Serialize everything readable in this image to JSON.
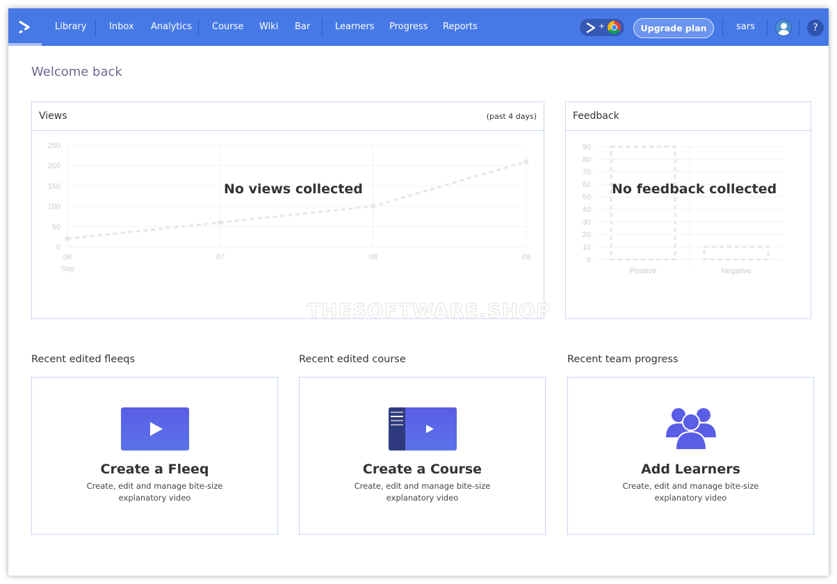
{
  "nav": {
    "items": [
      "Library",
      "Inbox",
      "Analytics",
      "Course",
      "Wiki",
      "Bar",
      "Learners",
      "Progress",
      "Reports"
    ],
    "active": "Library",
    "upgrade": "Upgrade plan",
    "user": "sars",
    "help": "?",
    "ext_plus": "+",
    "accent": "#4779e6"
  },
  "welcome": "Welcome back",
  "views": {
    "title": "Views",
    "range": "(past 4 days)",
    "empty": "No views collected"
  },
  "feedback": {
    "title": "Feedback",
    "empty": "No feedback collected"
  },
  "watermark": "THESOFTWARE.SHOP",
  "sections": {
    "fleeqs": "Recent edited fleeqs",
    "course": "Recent edited course",
    "team": "Recent team progress"
  },
  "cards": [
    {
      "title": "Create a Fleeq",
      "desc": "Create, edit and manage bite-size explanatory video",
      "icon": "video-play-icon"
    },
    {
      "title": "Create a Course",
      "desc": "Create, edit and manage bite-size explanatory video",
      "icon": "course-video-icon"
    },
    {
      "title": "Add Learners",
      "desc": "Create, edit and manage bite-size explanatory video",
      "icon": "users-group-icon"
    }
  ],
  "chart_data": [
    {
      "type": "line",
      "title": "Views",
      "categories": [
        "06 Sep",
        "07",
        "08",
        "09"
      ],
      "values": [
        20,
        60,
        100,
        210
      ],
      "ylim": [
        0,
        250
      ],
      "yticks": [
        0,
        50,
        100,
        150,
        200,
        250
      ],
      "grid": true,
      "style": "dashed placeholder"
    },
    {
      "type": "bar",
      "title": "Feedback",
      "categories": [
        "Positive",
        "Negative"
      ],
      "values": [
        90,
        10
      ],
      "ylim": [
        0,
        90
      ],
      "yticks": [
        0,
        10,
        20,
        30,
        40,
        50,
        60,
        70,
        80,
        90
      ],
      "grid": true,
      "style": "dashed placeholder"
    }
  ]
}
